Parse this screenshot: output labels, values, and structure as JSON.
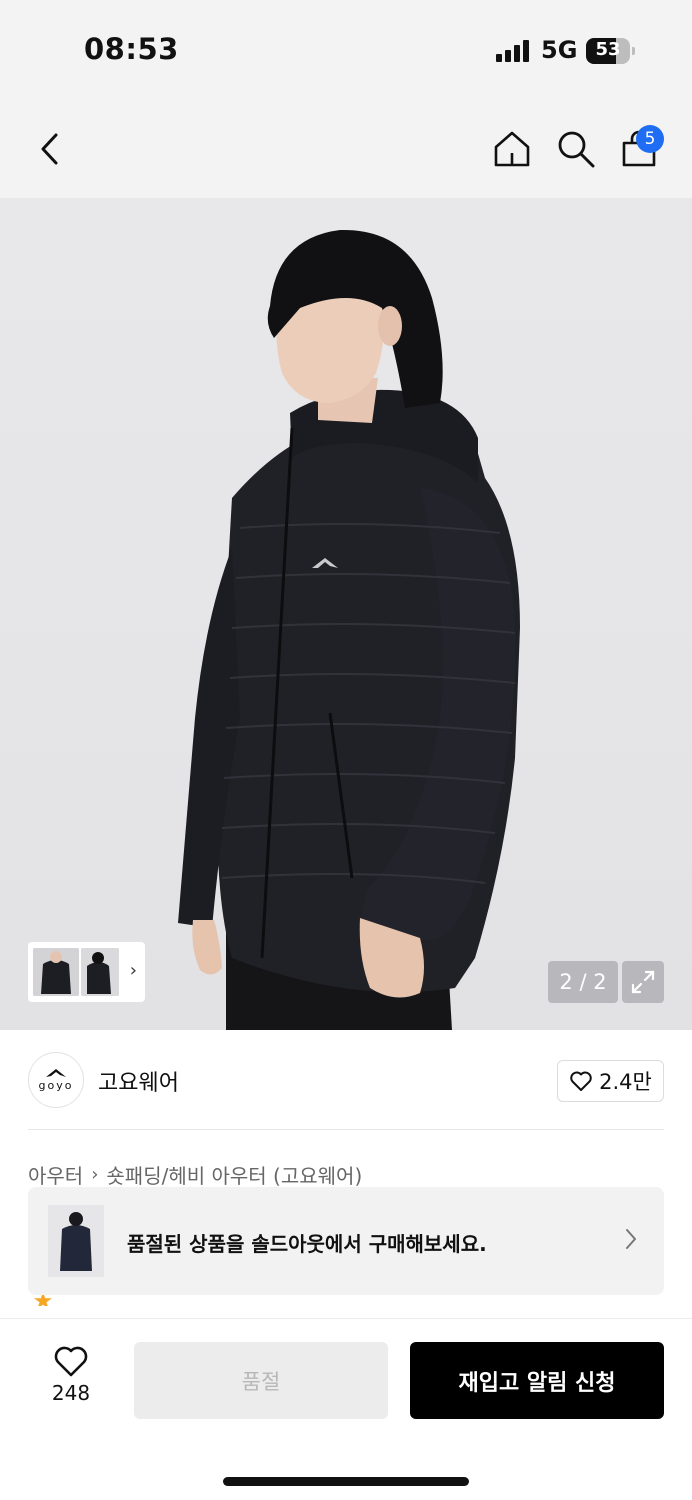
{
  "status_bar": {
    "time": "08:53",
    "network": "5G",
    "battery": "53"
  },
  "nav": {
    "cart_count": "5"
  },
  "gallery": {
    "counter": "2 / 2"
  },
  "brand": {
    "logo_text": "goyo",
    "name": "고요웨어",
    "likes": "2.4만"
  },
  "breadcrumb": {
    "category": "아우터",
    "subcategory": "숏패딩/헤비 아우터 (고요웨어)"
  },
  "soldout_banner": {
    "text": "품절된 상품을 솔드아웃에서 구매해보세요."
  },
  "bottom_bar": {
    "wish_count": "248",
    "soldout_label": "품절",
    "restock_label": "재입고 알림 신청"
  },
  "colors": {
    "accent_blue": "#1f6df2",
    "primary_black": "#000000",
    "rating_star": "#f6a623"
  }
}
